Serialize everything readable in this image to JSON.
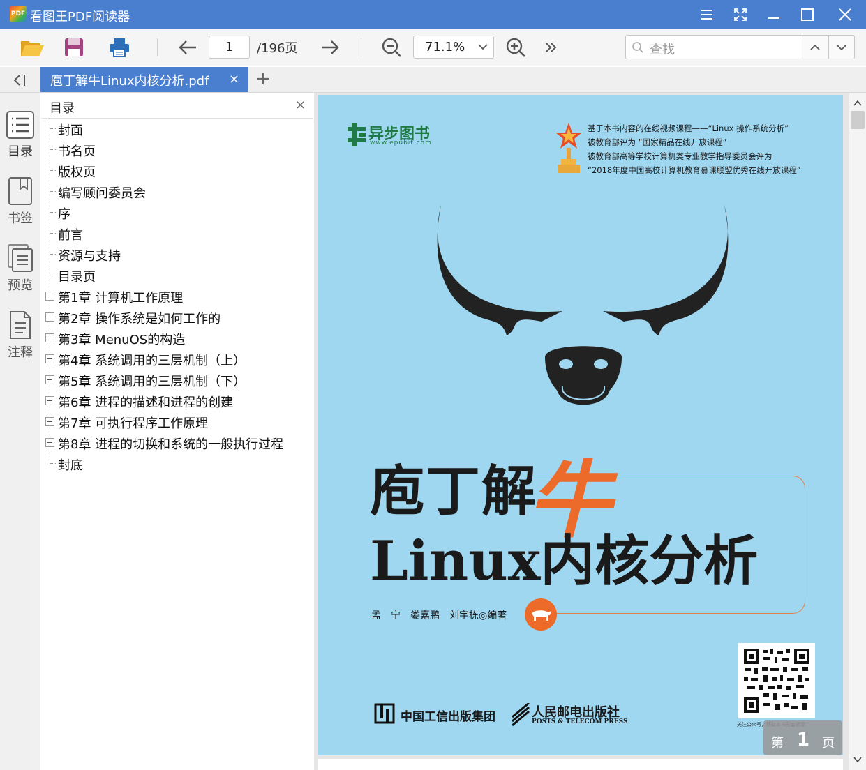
{
  "app": {
    "logo_text": "PDF",
    "title": "看图王PDF阅读器"
  },
  "toolbar": {
    "page_current": "1",
    "page_total": "/196页",
    "zoom": "71.1%",
    "search_placeholder": "查找"
  },
  "tabs": {
    "active_label": "庖丁解牛Linux内核分析.pdf",
    "close_glyph": "×",
    "add_glyph": "+"
  },
  "rail": {
    "items": [
      {
        "label": "目录",
        "icon": "toc-list-icon"
      },
      {
        "label": "书签",
        "icon": "bookmark-icon"
      },
      {
        "label": "预览",
        "icon": "thumbnails-icon"
      },
      {
        "label": "注释",
        "icon": "annotation-icon"
      }
    ]
  },
  "outline": {
    "title": "目录",
    "close_glyph": "×",
    "items": [
      {
        "label": "封面",
        "expandable": false
      },
      {
        "label": "书名页",
        "expandable": false
      },
      {
        "label": "版权页",
        "expandable": false
      },
      {
        "label": "编写顾问委员会",
        "expandable": false
      },
      {
        "label": "序",
        "expandable": false
      },
      {
        "label": "前言",
        "expandable": false
      },
      {
        "label": "资源与支持",
        "expandable": false
      },
      {
        "label": "目录页",
        "expandable": false
      },
      {
        "label": "第1章 计算机工作原理",
        "expandable": true
      },
      {
        "label": "第2章 操作系统是如何工作的",
        "expandable": true
      },
      {
        "label": "第3章 MenuOS的构造",
        "expandable": true
      },
      {
        "label": "第4章 系统调用的三层机制（上）",
        "expandable": true
      },
      {
        "label": "第5章 系统调用的三层机制（下）",
        "expandable": true
      },
      {
        "label": "第6章 进程的描述和进程的创建",
        "expandable": true
      },
      {
        "label": "第7章 可执行程序工作原理",
        "expandable": true
      },
      {
        "label": "第8章 进程的切换和系统的一般执行过程",
        "expandable": true
      },
      {
        "label": "封底",
        "expandable": false
      }
    ]
  },
  "cover": {
    "publisher_logo": "异步图书",
    "publisher_url": "www.epubit.com",
    "award_lines": [
      "基于本书内容的在线视频课程——“Linux 操作系统分析”",
      "被教育部评为 “国家精品在线开放课程”",
      "被教育部高等学校计算机类专业教学指导委员会评为",
      "“2018年度中国高校计算机教育慕课联盟优秀在线开放课程”"
    ],
    "title_line1": "庖丁解",
    "title_accent": "牛",
    "title_line2": "Linux内核分析",
    "authors": "孟　宁　娄嘉鹏　刘宇栋◎编著",
    "qr_caption": "关注公众号，获取本书配套资源",
    "publisher_group": "中国工信出版集团",
    "publisher_press": "人民邮电出版社",
    "publisher_press_en": "POSTS & TELECOM PRESS"
  },
  "page_indicator": {
    "prefix": "第",
    "number": "1",
    "suffix": "页"
  },
  "colors": {
    "titlebar": "#4a7fd0",
    "cover_bg": "#9fd7f0",
    "accent_orange": "#ec6a2a"
  }
}
